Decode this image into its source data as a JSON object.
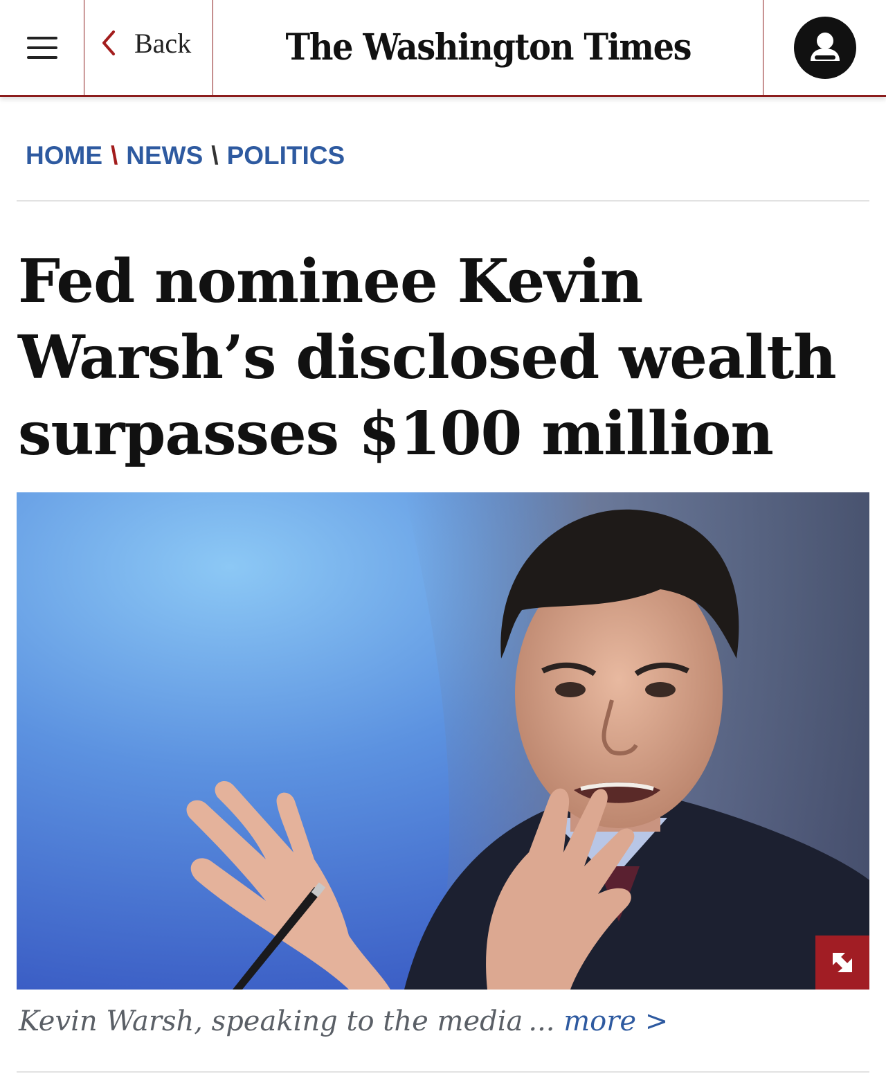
{
  "header": {
    "menu_icon": "hamburger-menu-icon",
    "back_label": "Back",
    "back_icon": "chevron-left-icon",
    "masthead": "The Washington Times",
    "account_icon": "user-account-icon",
    "accent_color": "#8b1c1c"
  },
  "breadcrumb": {
    "items": [
      "HOME",
      "NEWS",
      "POLITICS"
    ],
    "separator": "\\",
    "link_color": "#2e5aa0"
  },
  "article": {
    "headline": "Fed nominee Kevin Warsh’s disclosed wealth surpasses $100 million",
    "photo": {
      "expand_icon": "expand-arrow-icon",
      "expand_color": "#a11d24"
    },
    "caption": {
      "text": "Kevin Warsh, speaking to the media ...",
      "more_label": "more >"
    }
  }
}
